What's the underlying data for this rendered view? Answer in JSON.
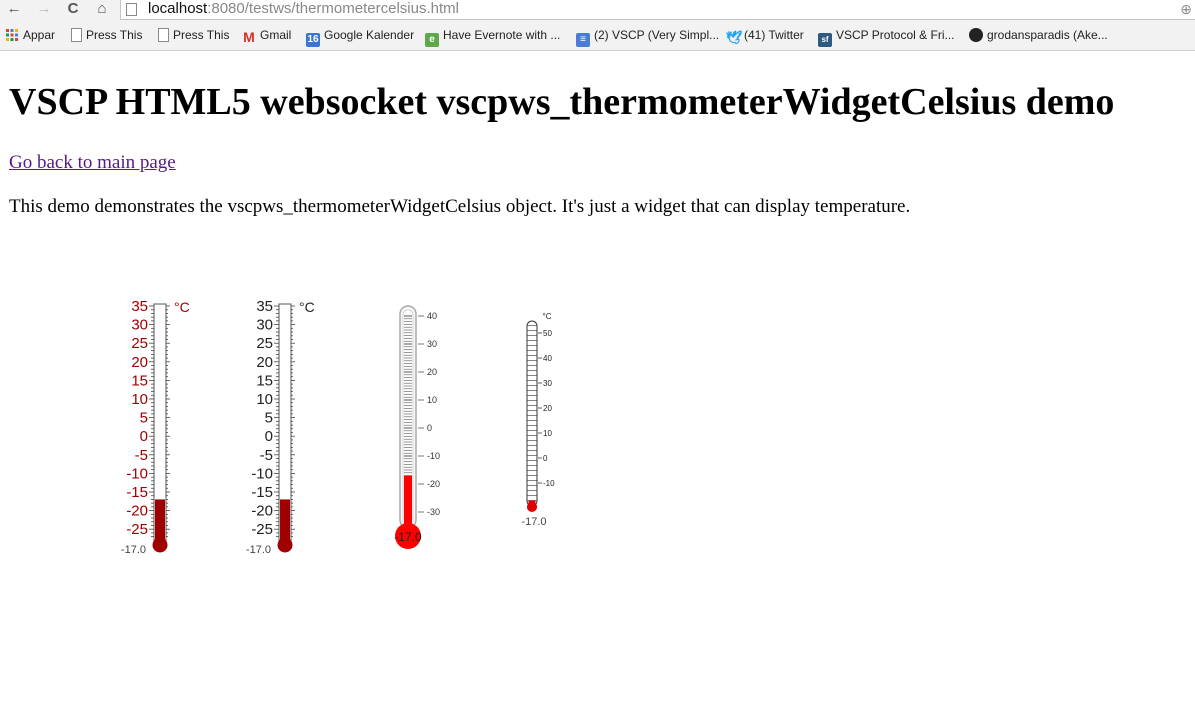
{
  "browser": {
    "url_host": "localhost",
    "url_rest": ":8080/testws/thermometercelsius.html",
    "nav": {
      "back": "←",
      "forward": "→",
      "reload": "C",
      "home": "⌂"
    },
    "bookmarks": [
      {
        "label": "Appar",
        "icon": "apps-grid-icon"
      },
      {
        "label": "Press This",
        "icon": "page-icon"
      },
      {
        "label": "Press This",
        "icon": "page-icon"
      },
      {
        "label": "Gmail",
        "icon": "gmail-icon"
      },
      {
        "label": "Google Kalender",
        "icon": "calendar-icon",
        "badge": "16"
      },
      {
        "label": "Have Evernote with ...",
        "icon": "evernote-icon"
      },
      {
        "label": "(2) VSCP (Very Simpl...",
        "icon": "vscp-icon"
      },
      {
        "label": "(41) Twitter",
        "icon": "twitter-icon"
      },
      {
        "label": "VSCP Protocol & Fri...",
        "icon": "sourceforge-icon",
        "badge": "sf"
      },
      {
        "label": "grodansparadis (Ake...",
        "icon": "github-icon"
      }
    ]
  },
  "page": {
    "title": "VSCP HTML5 websocket vscpws_thermometerWidgetCelsius demo",
    "back_link": "Go back to main page",
    "description": "This demo demonstrates the vscpws_thermometerWidgetCelsius object. It's just a widget that can display temperature."
  },
  "thermometers": [
    {
      "style": "scale-left",
      "unit": "°C",
      "readout": "-17.0",
      "value": -17.0,
      "color": "#a00000",
      "label_color": "#a00000",
      "ticks": [
        "35",
        "30",
        "25",
        "20",
        "15",
        "10",
        "5",
        "0",
        "-5",
        "-10",
        "-15",
        "-20",
        "-25"
      ]
    },
    {
      "style": "scale-left",
      "unit": "°C",
      "readout": "-17.0",
      "value": -17.0,
      "color": "#a00000",
      "label_color": "#222222",
      "ticks": [
        "35",
        "30",
        "25",
        "20",
        "15",
        "10",
        "5",
        "0",
        "-5",
        "-10",
        "-15",
        "-20",
        "-25"
      ]
    },
    {
      "style": "glass",
      "readout": "-17.0",
      "value": -17.0,
      "color": "#ff0000",
      "ticks": [
        "40",
        "30",
        "20",
        "10",
        "0",
        "-10",
        "-20",
        "-30"
      ]
    },
    {
      "style": "slim",
      "unit": "°C",
      "readout": "-17.0",
      "value": -17.0,
      "color": "#e00000",
      "ticks": [
        "50",
        "40",
        "30",
        "20",
        "10",
        "0",
        "-10"
      ]
    }
  ]
}
